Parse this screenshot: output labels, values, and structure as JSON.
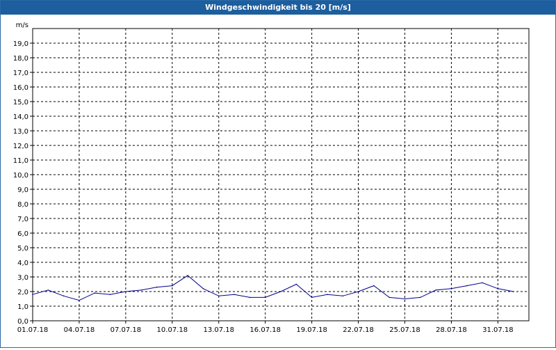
{
  "window": {
    "title": "Windgeschwindigkeit bis 20 [m/s]"
  },
  "chart_data": {
    "type": "line",
    "title": "Windgeschwindigkeit bis 20 [m/s]",
    "ylabel": "m/s",
    "xlabel": "",
    "ylim": [
      0,
      20
    ],
    "yticks": [
      "0,0",
      "1,0",
      "2,0",
      "3,0",
      "4,0",
      "5,0",
      "6,0",
      "7,0",
      "8,0",
      "9,0",
      "10,0",
      "11,0",
      "12,0",
      "13,0",
      "14,0",
      "15,0",
      "16,0",
      "17,0",
      "18,0",
      "19,0"
    ],
    "xticks": [
      "01.07.18",
      "04.07.18",
      "07.07.18",
      "10.07.18",
      "13.07.18",
      "16.07.18",
      "19.07.18",
      "22.07.18",
      "25.07.18",
      "28.07.18",
      "31.07.18"
    ],
    "xlim": [
      "01.07.18",
      "02.08.18"
    ],
    "grid": true,
    "series_color": "#00008b",
    "series": [
      {
        "x": [
          "01.07.18",
          "02.07.18",
          "03.07.18",
          "04.07.18",
          "05.07.18",
          "06.07.18",
          "07.07.18",
          "08.07.18",
          "09.07.18",
          "10.07.18",
          "11.07.18",
          "12.07.18",
          "13.07.18",
          "14.07.18",
          "15.07.18",
          "16.07.18",
          "17.07.18",
          "18.07.18",
          "19.07.18",
          "20.07.18",
          "21.07.18",
          "22.07.18",
          "23.07.18",
          "24.07.18",
          "25.07.18",
          "26.07.18",
          "27.07.18",
          "28.07.18",
          "29.07.18",
          "30.07.18",
          "31.07.18",
          "01.08.18"
        ],
        "values": [
          1.8,
          2.1,
          1.7,
          1.4,
          1.9,
          1.8,
          2.0,
          2.1,
          2.3,
          2.4,
          3.1,
          2.2,
          1.7,
          1.8,
          1.6,
          1.6,
          2.0,
          2.5,
          1.6,
          1.8,
          1.7,
          2.0,
          2.4,
          1.6,
          1.5,
          1.6,
          2.1,
          2.2,
          2.4,
          2.6,
          2.2,
          2.0
        ]
      }
    ]
  }
}
